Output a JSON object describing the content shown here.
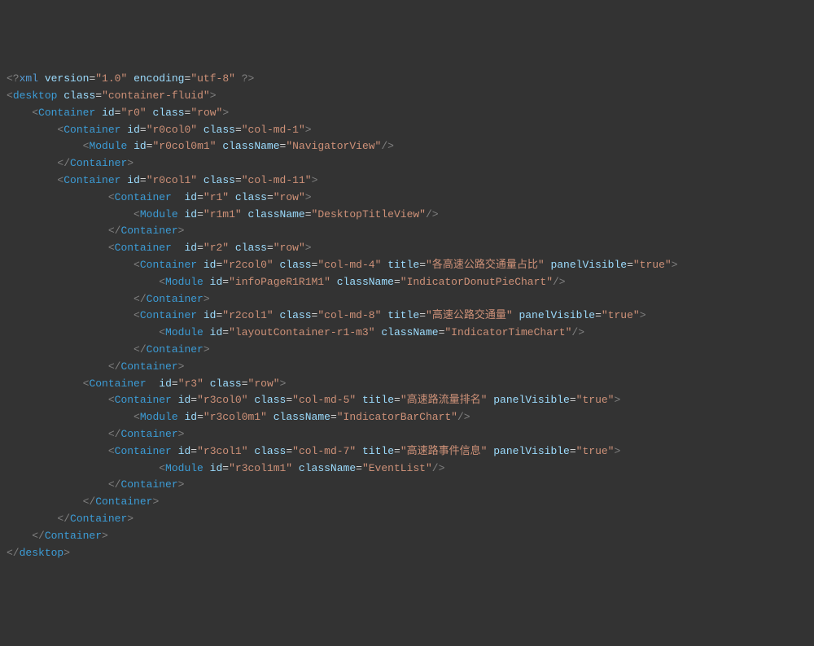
{
  "lines": [
    {
      "indent": 0,
      "tokens": [
        {
          "t": "pi",
          "v": "<?"
        },
        {
          "t": "xml-decl",
          "v": "xml"
        },
        {
          "t": "plain",
          "v": " "
        },
        {
          "t": "attr-name",
          "v": "version"
        },
        {
          "t": "eq",
          "v": "="
        },
        {
          "t": "attr-value",
          "v": "\"1.0\""
        },
        {
          "t": "plain",
          "v": " "
        },
        {
          "t": "attr-name",
          "v": "encoding"
        },
        {
          "t": "eq",
          "v": "="
        },
        {
          "t": "attr-value",
          "v": "\"utf-8\""
        },
        {
          "t": "plain",
          "v": " "
        },
        {
          "t": "pi",
          "v": "?>"
        }
      ]
    },
    {
      "indent": 0,
      "tokens": [
        {
          "t": "bracket",
          "v": "<"
        },
        {
          "t": "tag",
          "v": "desktop"
        },
        {
          "t": "plain",
          "v": " "
        },
        {
          "t": "attr-name",
          "v": "class"
        },
        {
          "t": "eq",
          "v": "="
        },
        {
          "t": "attr-value",
          "v": "\"container-fluid\""
        },
        {
          "t": "bracket",
          "v": ">"
        }
      ]
    },
    {
      "indent": 1,
      "tokens": [
        {
          "t": "bracket",
          "v": "<"
        },
        {
          "t": "tag",
          "v": "Container"
        },
        {
          "t": "plain",
          "v": " "
        },
        {
          "t": "attr-name",
          "v": "id"
        },
        {
          "t": "eq",
          "v": "="
        },
        {
          "t": "attr-value",
          "v": "\"r0\""
        },
        {
          "t": "plain",
          "v": " "
        },
        {
          "t": "attr-name",
          "v": "class"
        },
        {
          "t": "eq",
          "v": "="
        },
        {
          "t": "attr-value",
          "v": "\"row\""
        },
        {
          "t": "bracket",
          "v": ">"
        }
      ]
    },
    {
      "indent": 2,
      "tokens": [
        {
          "t": "bracket",
          "v": "<"
        },
        {
          "t": "tag",
          "v": "Container"
        },
        {
          "t": "plain",
          "v": " "
        },
        {
          "t": "attr-name",
          "v": "id"
        },
        {
          "t": "eq",
          "v": "="
        },
        {
          "t": "attr-value",
          "v": "\"r0col0\""
        },
        {
          "t": "plain",
          "v": " "
        },
        {
          "t": "attr-name",
          "v": "class"
        },
        {
          "t": "eq",
          "v": "="
        },
        {
          "t": "attr-value",
          "v": "\"col-md-1\""
        },
        {
          "t": "bracket",
          "v": ">"
        }
      ]
    },
    {
      "indent": 3,
      "tokens": [
        {
          "t": "bracket",
          "v": "<"
        },
        {
          "t": "tag",
          "v": "Module"
        },
        {
          "t": "plain",
          "v": " "
        },
        {
          "t": "attr-name",
          "v": "id"
        },
        {
          "t": "eq",
          "v": "="
        },
        {
          "t": "attr-value",
          "v": "\"r0col0m1\""
        },
        {
          "t": "plain",
          "v": " "
        },
        {
          "t": "attr-name",
          "v": "className"
        },
        {
          "t": "eq",
          "v": "="
        },
        {
          "t": "attr-value",
          "v": "\"NavigatorView\""
        },
        {
          "t": "bracket",
          "v": "/>"
        }
      ]
    },
    {
      "indent": 2,
      "tokens": [
        {
          "t": "bracket",
          "v": "</"
        },
        {
          "t": "tag",
          "v": "Container"
        },
        {
          "t": "bracket",
          "v": ">"
        }
      ]
    },
    {
      "indent": 2,
      "tokens": [
        {
          "t": "bracket",
          "v": "<"
        },
        {
          "t": "tag",
          "v": "Container"
        },
        {
          "t": "plain",
          "v": " "
        },
        {
          "t": "attr-name",
          "v": "id"
        },
        {
          "t": "eq",
          "v": "="
        },
        {
          "t": "attr-value",
          "v": "\"r0col1\""
        },
        {
          "t": "plain",
          "v": " "
        },
        {
          "t": "attr-name",
          "v": "class"
        },
        {
          "t": "eq",
          "v": "="
        },
        {
          "t": "attr-value",
          "v": "\"col-md-11\""
        },
        {
          "t": "bracket",
          "v": ">"
        }
      ]
    },
    {
      "indent": 4,
      "tokens": [
        {
          "t": "bracket",
          "v": "<"
        },
        {
          "t": "tag",
          "v": "Container"
        },
        {
          "t": "plain",
          "v": "  "
        },
        {
          "t": "attr-name",
          "v": "id"
        },
        {
          "t": "eq",
          "v": "="
        },
        {
          "t": "attr-value",
          "v": "\"r1\""
        },
        {
          "t": "plain",
          "v": " "
        },
        {
          "t": "attr-name",
          "v": "class"
        },
        {
          "t": "eq",
          "v": "="
        },
        {
          "t": "attr-value",
          "v": "\"row\""
        },
        {
          "t": "bracket",
          "v": ">"
        }
      ]
    },
    {
      "indent": 5,
      "tokens": [
        {
          "t": "bracket",
          "v": "<"
        },
        {
          "t": "tag",
          "v": "Module"
        },
        {
          "t": "plain",
          "v": " "
        },
        {
          "t": "attr-name",
          "v": "id"
        },
        {
          "t": "eq",
          "v": "="
        },
        {
          "t": "attr-value",
          "v": "\"r1m1\""
        },
        {
          "t": "plain",
          "v": " "
        },
        {
          "t": "attr-name",
          "v": "className"
        },
        {
          "t": "eq",
          "v": "="
        },
        {
          "t": "attr-value",
          "v": "\"DesktopTitleView\""
        },
        {
          "t": "bracket",
          "v": "/>"
        }
      ]
    },
    {
      "indent": 4,
      "tokens": [
        {
          "t": "bracket",
          "v": "</"
        },
        {
          "t": "tag",
          "v": "Container"
        },
        {
          "t": "bracket",
          "v": ">"
        }
      ]
    },
    {
      "indent": 4,
      "tokens": [
        {
          "t": "bracket",
          "v": "<"
        },
        {
          "t": "tag",
          "v": "Container"
        },
        {
          "t": "plain",
          "v": "  "
        },
        {
          "t": "attr-name",
          "v": "id"
        },
        {
          "t": "eq",
          "v": "="
        },
        {
          "t": "attr-value",
          "v": "\"r2\""
        },
        {
          "t": "plain",
          "v": " "
        },
        {
          "t": "attr-name",
          "v": "class"
        },
        {
          "t": "eq",
          "v": "="
        },
        {
          "t": "attr-value",
          "v": "\"row\""
        },
        {
          "t": "bracket",
          "v": ">"
        }
      ]
    },
    {
      "indent": 5,
      "tokens": [
        {
          "t": "bracket",
          "v": "<"
        },
        {
          "t": "tag",
          "v": "Container"
        },
        {
          "t": "plain",
          "v": " "
        },
        {
          "t": "attr-name",
          "v": "id"
        },
        {
          "t": "eq",
          "v": "="
        },
        {
          "t": "attr-value",
          "v": "\"r2col0\""
        },
        {
          "t": "plain",
          "v": " "
        },
        {
          "t": "attr-name",
          "v": "class"
        },
        {
          "t": "eq",
          "v": "="
        },
        {
          "t": "attr-value",
          "v": "\"col-md-4\""
        },
        {
          "t": "plain",
          "v": " "
        },
        {
          "t": "attr-name",
          "v": "title"
        },
        {
          "t": "eq",
          "v": "="
        },
        {
          "t": "attr-value",
          "v": "\"各高速公路交通量占比\""
        },
        {
          "t": "plain",
          "v": " "
        },
        {
          "t": "attr-name",
          "v": "panelVisible"
        },
        {
          "t": "eq",
          "v": "="
        },
        {
          "t": "attr-value",
          "v": "\"true\""
        },
        {
          "t": "bracket",
          "v": ">"
        }
      ]
    },
    {
      "indent": 6,
      "tokens": [
        {
          "t": "bracket",
          "v": "<"
        },
        {
          "t": "tag",
          "v": "Module"
        },
        {
          "t": "plain",
          "v": " "
        },
        {
          "t": "attr-name",
          "v": "id"
        },
        {
          "t": "eq",
          "v": "="
        },
        {
          "t": "attr-value",
          "v": "\"infoPageR1R1M1\""
        },
        {
          "t": "plain",
          "v": " "
        },
        {
          "t": "attr-name",
          "v": "className"
        },
        {
          "t": "eq",
          "v": "="
        },
        {
          "t": "attr-value",
          "v": "\"IndicatorDonutPieChart\""
        },
        {
          "t": "bracket",
          "v": "/>"
        }
      ]
    },
    {
      "indent": 5,
      "tokens": [
        {
          "t": "bracket",
          "v": "</"
        },
        {
          "t": "tag",
          "v": "Container"
        },
        {
          "t": "bracket",
          "v": ">"
        }
      ]
    },
    {
      "indent": 5,
      "tokens": [
        {
          "t": "bracket",
          "v": "<"
        },
        {
          "t": "tag",
          "v": "Container"
        },
        {
          "t": "plain",
          "v": " "
        },
        {
          "t": "attr-name",
          "v": "id"
        },
        {
          "t": "eq",
          "v": "="
        },
        {
          "t": "attr-value",
          "v": "\"r2col1\""
        },
        {
          "t": "plain",
          "v": " "
        },
        {
          "t": "attr-name",
          "v": "class"
        },
        {
          "t": "eq",
          "v": "="
        },
        {
          "t": "attr-value",
          "v": "\"col-md-8\""
        },
        {
          "t": "plain",
          "v": " "
        },
        {
          "t": "attr-name",
          "v": "title"
        },
        {
          "t": "eq",
          "v": "="
        },
        {
          "t": "attr-value",
          "v": "\"高速公路交通量\""
        },
        {
          "t": "plain",
          "v": " "
        },
        {
          "t": "attr-name",
          "v": "panelVisible"
        },
        {
          "t": "eq",
          "v": "="
        },
        {
          "t": "attr-value",
          "v": "\"true\""
        },
        {
          "t": "bracket",
          "v": ">"
        }
      ]
    },
    {
      "indent": 6,
      "tokens": [
        {
          "t": "bracket",
          "v": "<"
        },
        {
          "t": "tag",
          "v": "Module"
        },
        {
          "t": "plain",
          "v": " "
        },
        {
          "t": "attr-name",
          "v": "id"
        },
        {
          "t": "eq",
          "v": "="
        },
        {
          "t": "attr-value",
          "v": "\"layoutContainer-r1-m3\""
        },
        {
          "t": "plain",
          "v": " "
        },
        {
          "t": "attr-name",
          "v": "className"
        },
        {
          "t": "eq",
          "v": "="
        },
        {
          "t": "attr-value",
          "v": "\"IndicatorTimeChart\""
        },
        {
          "t": "bracket",
          "v": "/>"
        }
      ]
    },
    {
      "indent": 5,
      "tokens": [
        {
          "t": "bracket",
          "v": "</"
        },
        {
          "t": "tag",
          "v": "Container"
        },
        {
          "t": "bracket",
          "v": ">"
        }
      ]
    },
    {
      "indent": 4,
      "tokens": [
        {
          "t": "bracket",
          "v": "</"
        },
        {
          "t": "tag",
          "v": "Container"
        },
        {
          "t": "bracket",
          "v": ">"
        }
      ]
    },
    {
      "indent": 3,
      "tokens": [
        {
          "t": "bracket",
          "v": "<"
        },
        {
          "t": "tag",
          "v": "Container"
        },
        {
          "t": "plain",
          "v": "  "
        },
        {
          "t": "attr-name",
          "v": "id"
        },
        {
          "t": "eq",
          "v": "="
        },
        {
          "t": "attr-value",
          "v": "\"r3\""
        },
        {
          "t": "plain",
          "v": " "
        },
        {
          "t": "attr-name",
          "v": "class"
        },
        {
          "t": "eq",
          "v": "="
        },
        {
          "t": "attr-value",
          "v": "\"row\""
        },
        {
          "t": "bracket",
          "v": ">"
        }
      ]
    },
    {
      "indent": 4,
      "tokens": [
        {
          "t": "bracket",
          "v": "<"
        },
        {
          "t": "tag",
          "v": "Container"
        },
        {
          "t": "plain",
          "v": " "
        },
        {
          "t": "attr-name",
          "v": "id"
        },
        {
          "t": "eq",
          "v": "="
        },
        {
          "t": "attr-value",
          "v": "\"r3col0\""
        },
        {
          "t": "plain",
          "v": " "
        },
        {
          "t": "attr-name",
          "v": "class"
        },
        {
          "t": "eq",
          "v": "="
        },
        {
          "t": "attr-value",
          "v": "\"col-md-5\""
        },
        {
          "t": "plain",
          "v": " "
        },
        {
          "t": "attr-name",
          "v": "title"
        },
        {
          "t": "eq",
          "v": "="
        },
        {
          "t": "attr-value",
          "v": "\"高速路流量排名\""
        },
        {
          "t": "plain",
          "v": " "
        },
        {
          "t": "attr-name",
          "v": "panelVisible"
        },
        {
          "t": "eq",
          "v": "="
        },
        {
          "t": "attr-value",
          "v": "\"true\""
        },
        {
          "t": "bracket",
          "v": ">"
        }
      ]
    },
    {
      "indent": 5,
      "tokens": [
        {
          "t": "bracket",
          "v": "<"
        },
        {
          "t": "tag",
          "v": "Module"
        },
        {
          "t": "plain",
          "v": " "
        },
        {
          "t": "attr-name",
          "v": "id"
        },
        {
          "t": "eq",
          "v": "="
        },
        {
          "t": "attr-value",
          "v": "\"r3col0m1\""
        },
        {
          "t": "plain",
          "v": " "
        },
        {
          "t": "attr-name",
          "v": "className"
        },
        {
          "t": "eq",
          "v": "="
        },
        {
          "t": "attr-value",
          "v": "\"IndicatorBarChart\""
        },
        {
          "t": "bracket",
          "v": "/>"
        }
      ]
    },
    {
      "indent": 4,
      "tokens": [
        {
          "t": "bracket",
          "v": "</"
        },
        {
          "t": "tag",
          "v": "Container"
        },
        {
          "t": "bracket",
          "v": ">"
        }
      ]
    },
    {
      "indent": 4,
      "tokens": [
        {
          "t": "bracket",
          "v": "<"
        },
        {
          "t": "tag",
          "v": "Container"
        },
        {
          "t": "plain",
          "v": " "
        },
        {
          "t": "attr-name",
          "v": "id"
        },
        {
          "t": "eq",
          "v": "="
        },
        {
          "t": "attr-value",
          "v": "\"r3col1\""
        },
        {
          "t": "plain",
          "v": " "
        },
        {
          "t": "attr-name",
          "v": "class"
        },
        {
          "t": "eq",
          "v": "="
        },
        {
          "t": "attr-value",
          "v": "\"col-md-7\""
        },
        {
          "t": "plain",
          "v": " "
        },
        {
          "t": "attr-name",
          "v": "title"
        },
        {
          "t": "eq",
          "v": "="
        },
        {
          "t": "attr-value",
          "v": "\"高速路事件信息\""
        },
        {
          "t": "plain",
          "v": " "
        },
        {
          "t": "attr-name",
          "v": "panelVisible"
        },
        {
          "t": "eq",
          "v": "="
        },
        {
          "t": "attr-value",
          "v": "\"true\""
        },
        {
          "t": "bracket",
          "v": ">"
        }
      ]
    },
    {
      "indent": 6,
      "tokens": [
        {
          "t": "bracket",
          "v": "<"
        },
        {
          "t": "tag",
          "v": "Module"
        },
        {
          "t": "plain",
          "v": " "
        },
        {
          "t": "attr-name",
          "v": "id"
        },
        {
          "t": "eq",
          "v": "="
        },
        {
          "t": "attr-value",
          "v": "\"r3col1m1\""
        },
        {
          "t": "plain",
          "v": " "
        },
        {
          "t": "attr-name",
          "v": "className"
        },
        {
          "t": "eq",
          "v": "="
        },
        {
          "t": "attr-value",
          "v": "\"EventList\""
        },
        {
          "t": "bracket",
          "v": "/>"
        }
      ]
    },
    {
      "indent": 4,
      "tokens": [
        {
          "t": "bracket",
          "v": "</"
        },
        {
          "t": "tag",
          "v": "Container"
        },
        {
          "t": "bracket",
          "v": ">"
        }
      ]
    },
    {
      "indent": 3,
      "tokens": [
        {
          "t": "bracket",
          "v": "</"
        },
        {
          "t": "tag",
          "v": "Container"
        },
        {
          "t": "bracket",
          "v": ">"
        }
      ]
    },
    {
      "indent": 2,
      "tokens": [
        {
          "t": "bracket",
          "v": "</"
        },
        {
          "t": "tag",
          "v": "Container"
        },
        {
          "t": "bracket",
          "v": ">"
        }
      ]
    },
    {
      "indent": 1,
      "tokens": [
        {
          "t": "bracket",
          "v": "</"
        },
        {
          "t": "tag",
          "v": "Container"
        },
        {
          "t": "bracket",
          "v": ">"
        }
      ]
    },
    {
      "indent": 0,
      "tokens": [
        {
          "t": "bracket",
          "v": "</"
        },
        {
          "t": "tag",
          "v": "desktop"
        },
        {
          "t": "bracket",
          "v": ">"
        }
      ]
    }
  ],
  "indentUnit": "    "
}
